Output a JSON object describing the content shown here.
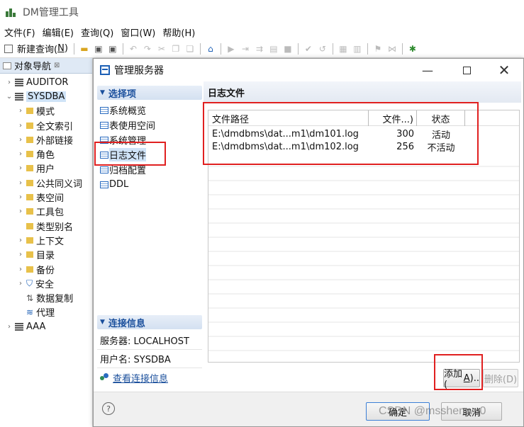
{
  "app": {
    "title": "DM管理工具"
  },
  "menu": [
    "文件(F)",
    "编辑(E)",
    "查询(Q)",
    "窗口(W)",
    "帮助(H)"
  ],
  "toolbar": {
    "new_query_label": "新建查询(",
    "new_query_key": "N",
    "new_query_end": ")"
  },
  "navigator": {
    "tab_label": "对象导航",
    "items": [
      {
        "label": "AUDITOR",
        "type": "db",
        "expand": "collapsed",
        "level": 0
      },
      {
        "label": "SYSDBA",
        "type": "db",
        "expand": "expanded",
        "level": 0,
        "selected": true
      },
      {
        "label": "模式",
        "type": "folder",
        "expand": "collapsed",
        "level": 1
      },
      {
        "label": "全文索引",
        "type": "folder",
        "expand": "collapsed",
        "level": 1
      },
      {
        "label": "外部链接",
        "type": "folder",
        "expand": "collapsed",
        "level": 1
      },
      {
        "label": "角色",
        "type": "folder",
        "expand": "collapsed",
        "level": 1
      },
      {
        "label": "用户",
        "type": "folder",
        "expand": "collapsed",
        "level": 1
      },
      {
        "label": "公共同义词",
        "type": "folder",
        "expand": "collapsed",
        "level": 1
      },
      {
        "label": "表空间",
        "type": "folder",
        "expand": "collapsed",
        "level": 1
      },
      {
        "label": "工具包",
        "type": "folder",
        "expand": "collapsed",
        "level": 1
      },
      {
        "label": "类型别名",
        "type": "folder",
        "expand": "none",
        "level": 1
      },
      {
        "label": "上下文",
        "type": "folder",
        "expand": "collapsed",
        "level": 1
      },
      {
        "label": "目录",
        "type": "folder",
        "expand": "collapsed",
        "level": 1
      },
      {
        "label": "备份",
        "type": "folder",
        "expand": "collapsed",
        "level": 1
      },
      {
        "label": "安全",
        "type": "shield",
        "expand": "collapsed",
        "level": 1
      },
      {
        "label": "数据复制",
        "type": "replication",
        "expand": "none",
        "level": 1
      },
      {
        "label": "代理",
        "type": "layers",
        "expand": "none",
        "level": 1
      },
      {
        "label": "AAA",
        "type": "db",
        "expand": "collapsed",
        "level": 0
      }
    ]
  },
  "dialog": {
    "title": "管理服务器",
    "select_section": "选择项",
    "options": [
      {
        "label": "系统概览"
      },
      {
        "label": "表使用空间"
      },
      {
        "label": "系统管理"
      },
      {
        "label": "日志文件",
        "active": true
      },
      {
        "label": "归档配置"
      },
      {
        "label": "DDL"
      }
    ],
    "conn_section": "连接信息",
    "server_label": "服务器: LOCALHOST",
    "user_label": "用户名: SYSDBA",
    "view_conn_link": "查看连接信息",
    "page_title": "日志文件",
    "grid": {
      "columns": [
        "文件路径",
        "文件...)",
        "状态"
      ],
      "rows": [
        {
          "path": "E:\\dmdbms\\dat...m1\\dm101.log",
          "size": "300",
          "status": "活动"
        },
        {
          "path": "E:\\dmdbms\\dat...m1\\dm102.log",
          "size": "256",
          "status": "不活动"
        }
      ]
    },
    "add_button": {
      "label": "添加(",
      "key": "A",
      "end": ").."
    },
    "delete_button": {
      "label": "删除(D)"
    },
    "ok_button": {
      "label": "确定"
    },
    "cancel_button": {
      "label": "取消"
    }
  },
  "watermark": "CSDN @msshenwu0"
}
